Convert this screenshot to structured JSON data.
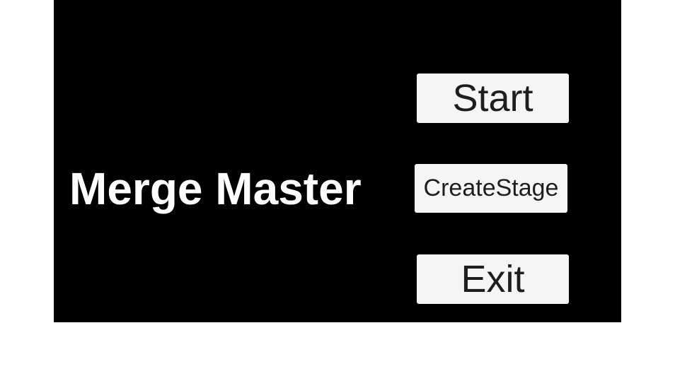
{
  "game": {
    "title": "Merge Master",
    "menu": {
      "start_label": "Start",
      "create_stage_label": "CreateStage",
      "exit_label": "Exit"
    }
  },
  "colors": {
    "background": "#000000",
    "title_text": "#ffffff",
    "button_background": "#f5f5f5",
    "button_text": "#1e1e1e"
  }
}
